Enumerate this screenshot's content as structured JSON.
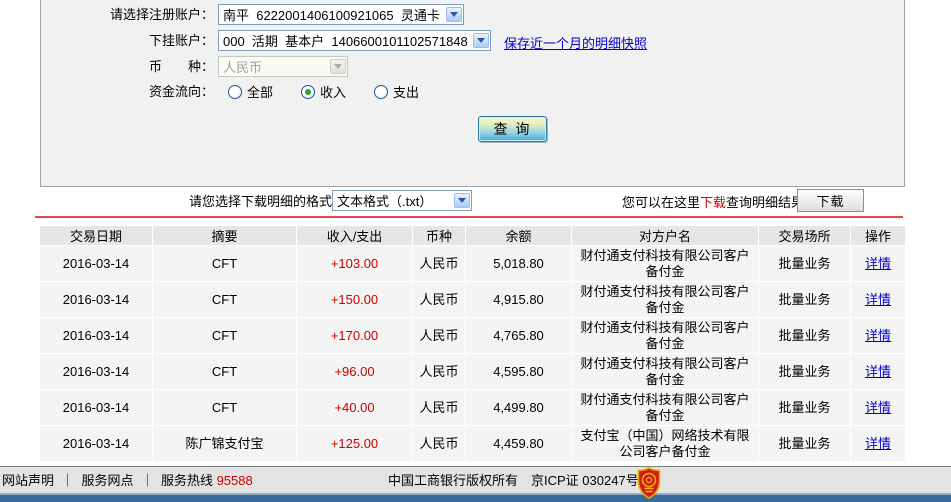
{
  "form": {
    "register_account_label": "请选择注册账户：",
    "register_account_value": "南平  6222001406100921065  灵通卡",
    "sub_account_label": "下挂账户：",
    "sub_account_value": "000  活期  基本户  1406600101102571848",
    "snapshot_link_label": "保存近一个月的明细快照",
    "currency_label": "币　　种：",
    "currency_value": "人民币",
    "flow_label": "资金流向：",
    "flow_options": [
      {
        "label": "全部",
        "selected": false
      },
      {
        "label": "收入",
        "selected": true
      },
      {
        "label": "支出",
        "selected": false
      }
    ],
    "query_button_label": "查 询"
  },
  "download": {
    "format_label": "请您选择下载明细的格式",
    "format_value": "文本格式（.txt）",
    "hint_prefix": "您可以在这里",
    "hint_link": "下载",
    "hint_suffix": "查询明细结果",
    "download_button_label": "下载"
  },
  "table": {
    "headers": {
      "date": "交易日期",
      "summary": "摘要",
      "amount": "收入/支出",
      "currency": "币种",
      "balance": "余额",
      "counterparty": "对方户名",
      "place": "交易场所",
      "action": "操作"
    },
    "detail_link_label": "详情",
    "rows": [
      {
        "date": "2016-03-14",
        "summary": "CFT",
        "amount": "+103.00",
        "currency": "人民币",
        "balance": "5,018.80",
        "counterparty": "财付通支付科技有限公司客户备付金",
        "place": "批量业务"
      },
      {
        "date": "2016-03-14",
        "summary": "CFT",
        "amount": "+150.00",
        "currency": "人民币",
        "balance": "4,915.80",
        "counterparty": "财付通支付科技有限公司客户备付金",
        "place": "批量业务"
      },
      {
        "date": "2016-03-14",
        "summary": "CFT",
        "amount": "+170.00",
        "currency": "人民币",
        "balance": "4,765.80",
        "counterparty": "财付通支付科技有限公司客户备付金",
        "place": "批量业务"
      },
      {
        "date": "2016-03-14",
        "summary": "CFT",
        "amount": "+96.00",
        "currency": "人民币",
        "balance": "4,595.80",
        "counterparty": "财付通支付科技有限公司客户备付金",
        "place": "批量业务"
      },
      {
        "date": "2016-03-14",
        "summary": "CFT",
        "amount": "+40.00",
        "currency": "人民币",
        "balance": "4,499.80",
        "counterparty": "财付通支付科技有限公司客户备付金",
        "place": "批量业务"
      },
      {
        "date": "2016-03-14",
        "summary": "陈广锦支付宝",
        "amount": "+125.00",
        "currency": "人民币",
        "balance": "4,459.80",
        "counterparty": "支付宝（中国）网络技术有限公司客户备付金",
        "place": "批量业务"
      }
    ]
  },
  "footer": {
    "link_statement": "网站声明",
    "link_outlets": "服务网点",
    "separator": "｜",
    "hotline_label": "服务热线",
    "hotline_number": "95588",
    "copyright": "中国工商银行版权所有　京ICP证 030247号"
  },
  "colors": {
    "accent_red": "#CC0000",
    "link_blue": "#0000CC",
    "divider_red": "#DE4A4A",
    "footer_bar_blue": "#3A6B9D",
    "panel_gray": "#F1F1F1",
    "selected_radio_green": "#2EA42E"
  }
}
